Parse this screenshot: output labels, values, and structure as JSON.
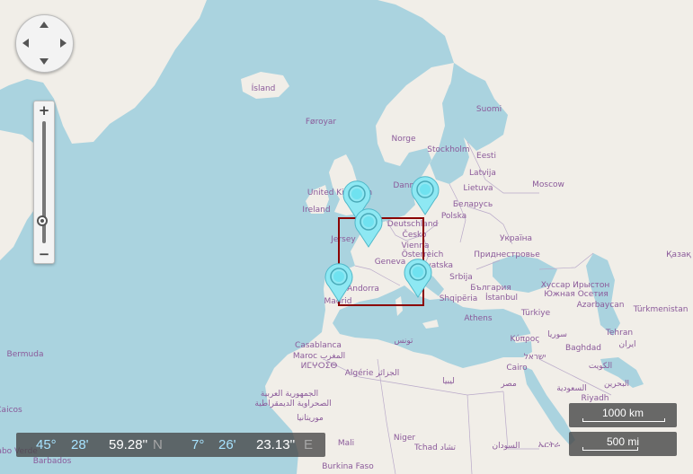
{
  "map": {
    "labels": [
      {
        "text": "Ísland",
        "sea": false
      },
      {
        "text": "Føroyar",
        "sea": false
      },
      {
        "text": "Norge",
        "sea": false
      },
      {
        "text": "Suomi",
        "sea": false
      },
      {
        "text": "Stockholm",
        "sea": false
      },
      {
        "text": "Eesti",
        "sea": false
      },
      {
        "text": "Latvija",
        "sea": false
      },
      {
        "text": "Lietuva",
        "sea": false
      },
      {
        "text": "Moscow",
        "sea": false
      },
      {
        "text": "Danmark",
        "sea": false
      },
      {
        "text": "United Kingdom",
        "sea": false
      },
      {
        "text": "Ireland",
        "sea": false
      },
      {
        "text": "Беларусь",
        "sea": false
      },
      {
        "text": "Polska",
        "sea": false
      },
      {
        "text": "Deutschland",
        "sea": false
      },
      {
        "text": "Česko",
        "sea": false
      },
      {
        "text": "Україна",
        "sea": false
      },
      {
        "text": "Jersey",
        "sea": false
      },
      {
        "text": "Vienna",
        "sea": false
      },
      {
        "text": "Österreich",
        "sea": false
      },
      {
        "text": "Geneva",
        "sea": false
      },
      {
        "text": "Hrvatska",
        "sea": false
      },
      {
        "text": "Приднестровье",
        "sea": false
      },
      {
        "text": "Қазақ",
        "sea": false
      },
      {
        "text": "Andorra",
        "sea": false
      },
      {
        "text": "Srbija",
        "sea": false
      },
      {
        "text": "България",
        "sea": false
      },
      {
        "text": "Хуссар Ирыстон",
        "sea": false
      },
      {
        "text": "Южная Осетия",
        "sea": false
      },
      {
        "text": "Azərbaycan",
        "sea": false
      },
      {
        "text": "Madrid",
        "sea": false
      },
      {
        "text": "Shqipëria",
        "sea": false
      },
      {
        "text": "İstanbul",
        "sea": false
      },
      {
        "text": "Türkmenistan",
        "sea": false
      },
      {
        "text": "Türkiye",
        "sea": false
      },
      {
        "text": "Athens",
        "sea": false
      },
      {
        "text": "Tehran",
        "sea": false
      },
      {
        "text": "سوريا",
        "sea": false
      },
      {
        "text": "Κύπρος",
        "sea": false
      },
      {
        "text": "تونس",
        "sea": false
      },
      {
        "text": "Casablanca",
        "sea": false
      },
      {
        "text": "Maroc المغرب",
        "sea": false
      },
      {
        "text": "ⵍⵎⵖⵔⵉⴱ",
        "sea": false
      },
      {
        "text": "Baghdad",
        "sea": false
      },
      {
        "text": "ایران",
        "sea": false
      },
      {
        "text": "Algérie الجزائر",
        "sea": false
      },
      {
        "text": "ישראל",
        "sea": false
      },
      {
        "text": "Cairo",
        "sea": false
      },
      {
        "text": "الكويت",
        "sea": false
      },
      {
        "text": "ليبيا",
        "sea": false
      },
      {
        "text": "مصر",
        "sea": false
      },
      {
        "text": "السعودية",
        "sea": false
      },
      {
        "text": "Riyadh",
        "sea": false
      },
      {
        "text": "البحرين",
        "sea": false
      },
      {
        "text": "الجمهورية العربية",
        "sea": false
      },
      {
        "text": "الصحراوية الديمقراطية",
        "sea": false
      },
      {
        "text": "موريتانيا",
        "sea": false
      },
      {
        "text": "Mali",
        "sea": false
      },
      {
        "text": "Niger",
        "sea": false
      },
      {
        "text": "Tchad تشاد",
        "sea": false
      },
      {
        "text": "السودان",
        "sea": false
      },
      {
        "text": "ኤርትራ",
        "sea": false
      },
      {
        "text": "Bermuda",
        "sea": false
      },
      {
        "text": "Caicos",
        "sea": false
      },
      {
        "text": "Barbados",
        "sea": false
      },
      {
        "text": "Burkina Faso",
        "sea": false
      },
      {
        "text": "Cabo Verde",
        "sea": false
      }
    ],
    "markers": [
      {
        "name": "map-pin-uk",
        "color": "#8ee8f3"
      },
      {
        "name": "map-pin-germany",
        "color": "#8ee8f3"
      },
      {
        "name": "map-pin-denmark",
        "color": "#8ee8f3"
      },
      {
        "name": "map-pin-spain",
        "color": "#8ee8f3"
      },
      {
        "name": "map-pin-italy",
        "color": "#8ee8f3"
      }
    ],
    "colors": {
      "water": "#aad3df",
      "land": "#f1eee8",
      "selection": "#8b0000",
      "pin": "#8ee8f3"
    }
  },
  "controls": {
    "pan_icons": [
      "arrow-up-icon",
      "arrow-down-icon",
      "arrow-left-icon",
      "arrow-right-icon"
    ],
    "zoom": {
      "plus": "+",
      "minus": "−",
      "level": 0.15
    }
  },
  "coordinates": {
    "lat_deg": "45°",
    "lat_min": "28'",
    "lat_sec": "59.28''",
    "lat_dir": "N",
    "lon_deg": "7°",
    "lon_min": "26'",
    "lon_sec": "23.13''",
    "lon_dir": "E"
  },
  "scale": {
    "km": "1000 km",
    "mi": "500 mi"
  }
}
